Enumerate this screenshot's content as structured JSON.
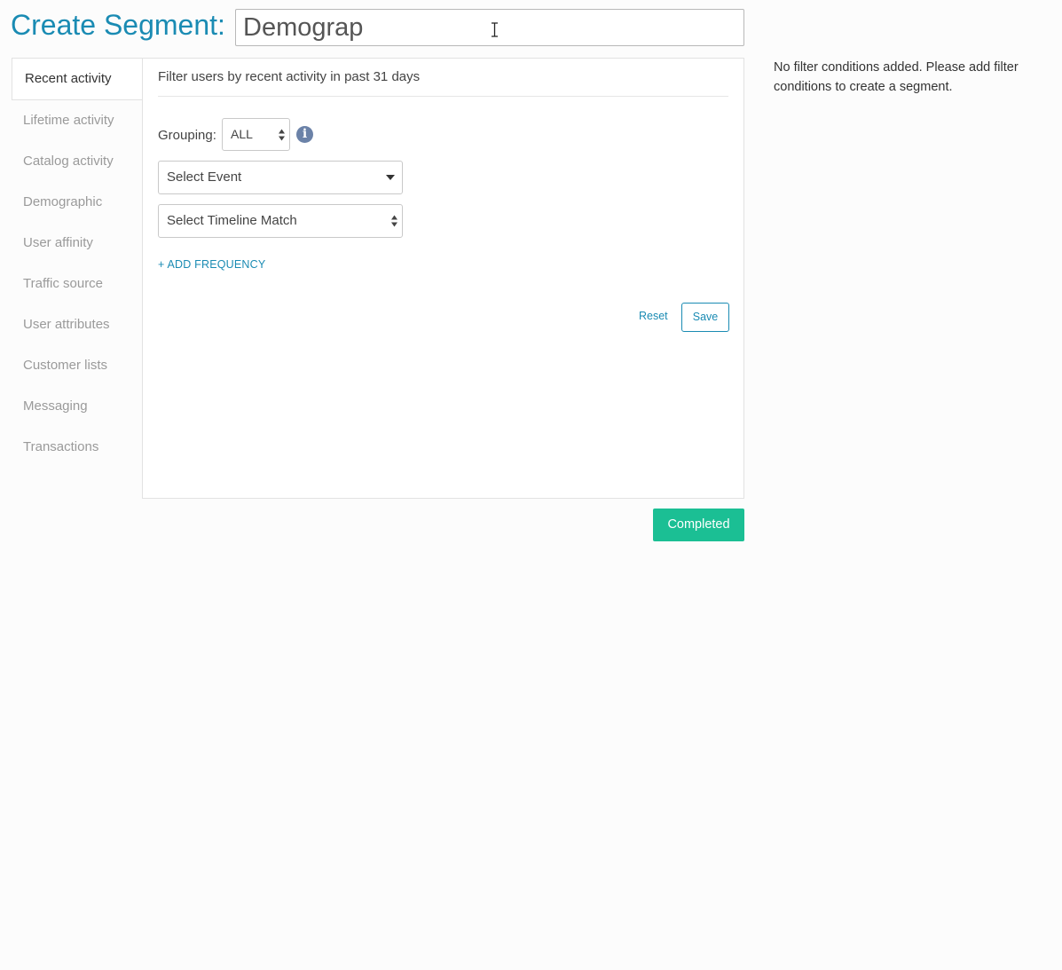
{
  "header": {
    "title": "Create Segment:",
    "segment_name_value": "Demograp"
  },
  "tabs": [
    {
      "label": "Recent activity",
      "active": true
    },
    {
      "label": "Lifetime activity"
    },
    {
      "label": "Catalog activity"
    },
    {
      "label": "Demographic"
    },
    {
      "label": "User affinity"
    },
    {
      "label": "Traffic source"
    },
    {
      "label": "User attributes"
    },
    {
      "label": "Customer lists"
    },
    {
      "label": "Messaging"
    },
    {
      "label": "Transactions"
    }
  ],
  "panel": {
    "heading": "Filter users by recent activity in past 31 days",
    "grouping_label": "Grouping:",
    "grouping_value": "ALL",
    "event_select": "Select Event",
    "timeline_select": "Select Timeline Match",
    "add_frequency": "+ ADD FREQUENCY",
    "reset_label": "Reset",
    "save_label": "Save",
    "info_glyph": "i"
  },
  "footer": {
    "completed_label": "Completed"
  },
  "summary": {
    "empty_message": "No filter conditions added. Please add filter conditions to create a segment."
  },
  "icons": {
    "info": "info-circle-icon",
    "cursor": "text-cursor-icon",
    "dropdown": "caret-down-icon",
    "updown": "updown-arrows-icon"
  },
  "colors": {
    "accent": "#1a8bb3",
    "completed": "#1bbf94",
    "info": "#6b82a8"
  }
}
